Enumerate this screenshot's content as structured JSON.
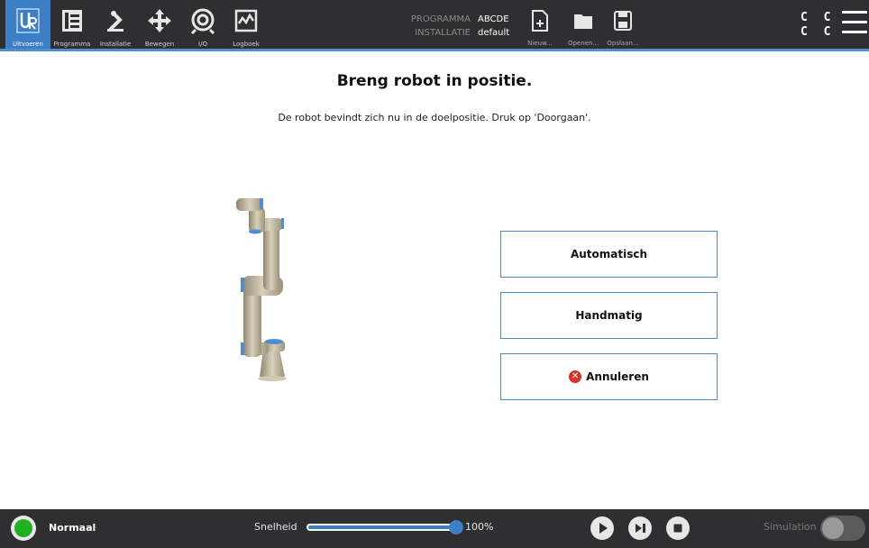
{
  "header": {
    "nav": [
      {
        "id": "run",
        "label": "Uitvoeren",
        "icon": "ur-logo-icon",
        "active": true
      },
      {
        "id": "program",
        "label": "Programma",
        "icon": "program-icon",
        "active": false
      },
      {
        "id": "installation",
        "label": "Installatie",
        "icon": "robot-arm-icon",
        "active": false
      },
      {
        "id": "move",
        "label": "Bewegen",
        "icon": "move-arrows-icon",
        "active": false
      },
      {
        "id": "io",
        "label": "I/O",
        "icon": "io-icon",
        "active": false
      },
      {
        "id": "log",
        "label": "Logboek",
        "icon": "log-icon",
        "active": false
      }
    ],
    "program_key": "PROGRAMMA",
    "program_value": "ABCDE",
    "installation_key": "INSTALLATIE",
    "installation_value": "default",
    "file_actions": [
      {
        "id": "new",
        "label": "Nieuw...",
        "icon": "new-file-icon"
      },
      {
        "id": "open",
        "label": "Openen...",
        "icon": "folder-icon"
      },
      {
        "id": "save",
        "label": "Opslaan...",
        "icon": "save-icon"
      }
    ],
    "control_code": "C C C C",
    "control_code_line1": "C C",
    "control_code_line2": "C C",
    "accent_color": "#3d7fc4"
  },
  "main": {
    "title": "Breng robot in positie.",
    "subtitle": "De robot bevindt zich nu in de doelpositie. Druk op 'Doorgaan'.",
    "buttons": {
      "auto": "Automatisch",
      "manual": "Handmatig",
      "cancel": "Annuleren",
      "cancel_icon": "x-circle-icon"
    }
  },
  "footer": {
    "status": "Normaal",
    "status_color": "#1fb11f",
    "speed_label": "Snelheid",
    "speed_value": "100%",
    "speed_fraction": 1.0,
    "controls": [
      "play-icon",
      "step-icon",
      "stop-icon"
    ],
    "simulation_label": "Simulation",
    "simulation_on": false
  }
}
